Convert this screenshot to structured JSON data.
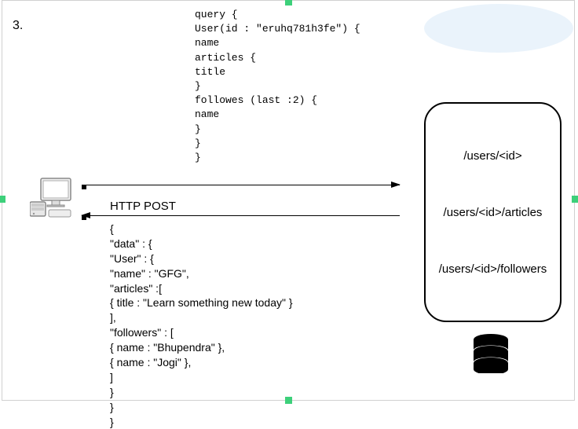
{
  "page_number": "3.",
  "query_code": "query {\nUser(id : \"eruhq781h3fe\") {\nname\narticles {\ntitle\n}\nfollowes (last :2) {\nname\n}\n}\n}",
  "http_method_label": "HTTP POST",
  "response_code": "{\n\"data\" : {\n\"User\" : {\n\"name\" : \"GFG\",\n\"articles\" :[\n{ title : \"Learn something new today\" }\n],\n\"followers\" : [\n{ name : \"Bhupendra\" },\n{ name : \"Jogi\" },\n]\n}\n}\n}",
  "endpoints": {
    "users": "/users/<id>",
    "articles": "/users/<id>/articles",
    "followers": "/users/<id>/followers"
  }
}
